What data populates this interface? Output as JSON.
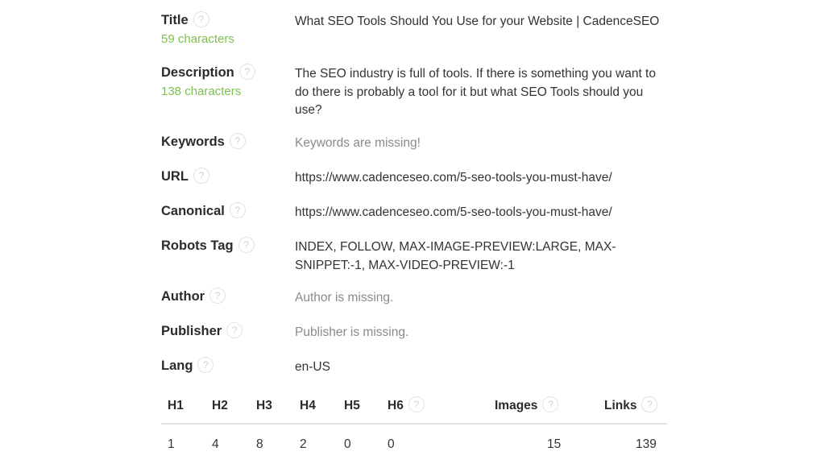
{
  "meta_rows": [
    {
      "label": "Title",
      "sub": "59 characters",
      "value": "What SEO Tools Should You Use for your Website | CadenceSEO",
      "missing": false
    },
    {
      "label": "Description",
      "sub": "138 characters",
      "value": "The SEO industry is full of tools. If there is something you want to do there is probably a tool for it but what SEO Tools should you use?",
      "missing": false
    },
    {
      "label": "Keywords",
      "value": "Keywords are missing!",
      "missing": true
    },
    {
      "label": "URL",
      "value": "https://www.cadenceseo.com/5-seo-tools-you-must-have/",
      "missing": false
    },
    {
      "label": "Canonical",
      "value": "https://www.cadenceseo.com/5-seo-tools-you-must-have/",
      "missing": false
    },
    {
      "label": "Robots Tag",
      "value": "INDEX, FOLLOW, MAX-IMAGE-PREVIEW:LARGE, MAX-SNIPPET:-1, MAX-VIDEO-PREVIEW:-1",
      "missing": false
    },
    {
      "label": "Author",
      "value": "Author is missing.",
      "missing": true
    },
    {
      "label": "Publisher",
      "value": "Publisher is missing.",
      "missing": true
    },
    {
      "label": "Lang",
      "value": "en-US",
      "missing": false
    }
  ],
  "help_icon": {
    "glyph": "?",
    "name": "help-icon"
  },
  "colors": {
    "sub_text": "#7cbf4f",
    "missing_text": "#8a8a8a",
    "label": "#2b2b2b"
  },
  "stats_table": {
    "headers": [
      "H1",
      "H2",
      "H3",
      "H4",
      "H5",
      "H6",
      "Images",
      "Links"
    ],
    "values": [
      "1",
      "4",
      "8",
      "2",
      "0",
      "0",
      "15",
      "139"
    ]
  }
}
